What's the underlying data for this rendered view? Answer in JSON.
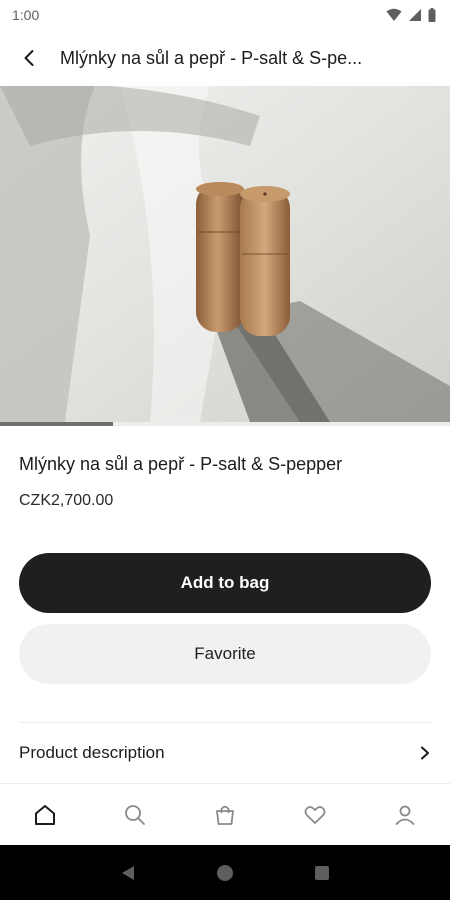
{
  "status_bar": {
    "time": "1:00"
  },
  "app_bar": {
    "title": "Mlýnky na sůl a pepř - P-salt & S-pe..."
  },
  "product": {
    "title": "Mlýnky na sůl a pepř - P-salt & S-pepper",
    "price": "CZK2,700.00",
    "image_index": 0,
    "image_count": 4
  },
  "actions": {
    "add_to_bag": "Add to bag",
    "favorite": "Favorite"
  },
  "sections": {
    "description_label": "Product description"
  },
  "bottom_nav": {
    "items": [
      "home-icon",
      "search-icon",
      "bag-icon",
      "heart-icon",
      "profile-icon"
    ],
    "active": "home-icon"
  },
  "colors": {
    "primary": "#1f1f1f",
    "secondary_bg": "#f1f1f1",
    "background": "#ffffff"
  }
}
